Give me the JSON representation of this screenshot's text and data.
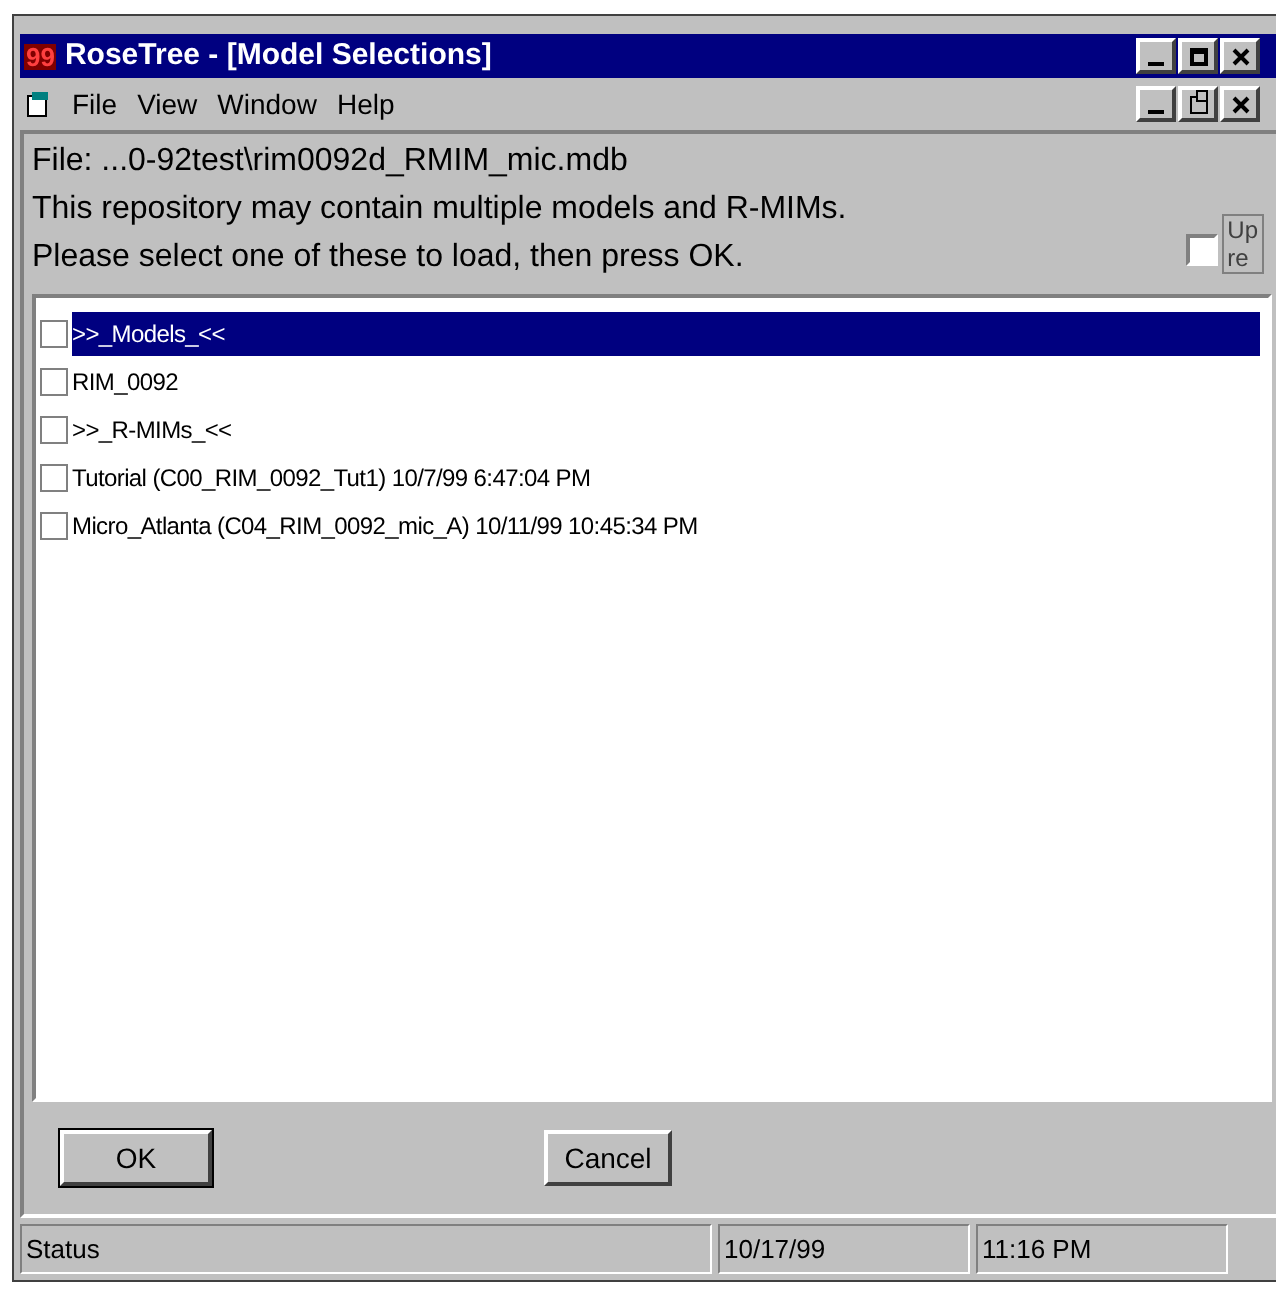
{
  "window": {
    "title": "RoseTree - [Model Selections]",
    "app_icon_text": "99"
  },
  "menu": [
    "File",
    "View",
    "Window",
    "Help"
  ],
  "dialog": {
    "file_line": "File: ...0-92test\\rim0092d_RMIM_mic.mdb",
    "info_lines": [
      "This repository may contain multiple models and R-MIMs.",
      "Please select one of these to load, then press OK."
    ],
    "side_option": {
      "checked": false,
      "label_lines": [
        "Up",
        "re"
      ]
    },
    "items": [
      {
        "label": ">>_Models_<<",
        "checked": false,
        "selected": true
      },
      {
        "label": "RIM_0092",
        "checked": false,
        "selected": false
      },
      {
        "label": ">>_R-MIMs_<<",
        "checked": false,
        "selected": false
      },
      {
        "label": "Tutorial (C00_RIM_0092_Tut1) 10/7/99 6:47:04 PM",
        "checked": false,
        "selected": false
      },
      {
        "label": "Micro_Atlanta (C04_RIM_0092_mic_A) 10/11/99 10:45:34 PM",
        "checked": false,
        "selected": false
      }
    ],
    "buttons": [
      {
        "label": "OK",
        "default": true
      },
      {
        "label": "Cancel",
        "default": false
      }
    ]
  },
  "status_bar": [
    "Status",
    "10/17/99",
    "11:16 PM"
  ]
}
